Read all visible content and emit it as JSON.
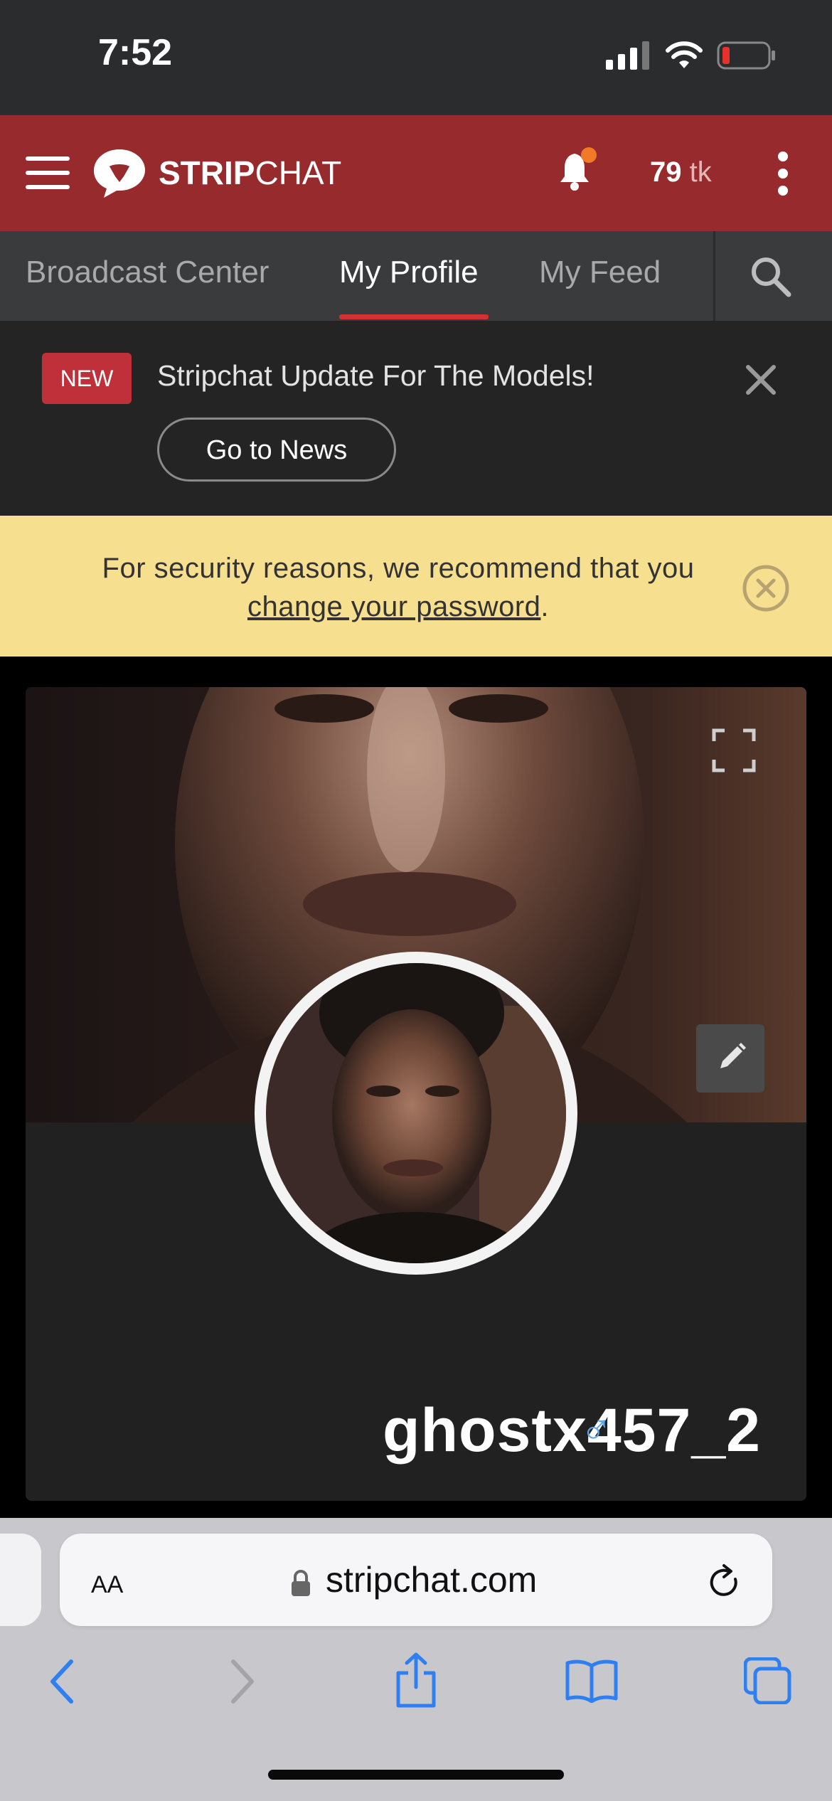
{
  "status_bar": {
    "time": "7:52"
  },
  "header": {
    "brand_bold": "STRIP",
    "brand_light": "CHAT",
    "tokens_value": "79",
    "tokens_unit": "tk",
    "accent": "#972a2c"
  },
  "tabs": [
    {
      "label": "Broadcast Center"
    },
    {
      "label": "My Profile"
    },
    {
      "label": "My Feed"
    }
  ],
  "news_banner": {
    "badge": "NEW",
    "text": "Stripchat Update For The Models!",
    "button": "Go to News"
  },
  "security_banner": {
    "text_prefix": "For security reasons, we recommend that you",
    "link": "change your password",
    "text_suffix": "."
  },
  "profile": {
    "username": "ghostx457_2",
    "gender_symbol": "♂"
  },
  "browser": {
    "text_size_label": "AA",
    "url": "stripchat.com"
  }
}
